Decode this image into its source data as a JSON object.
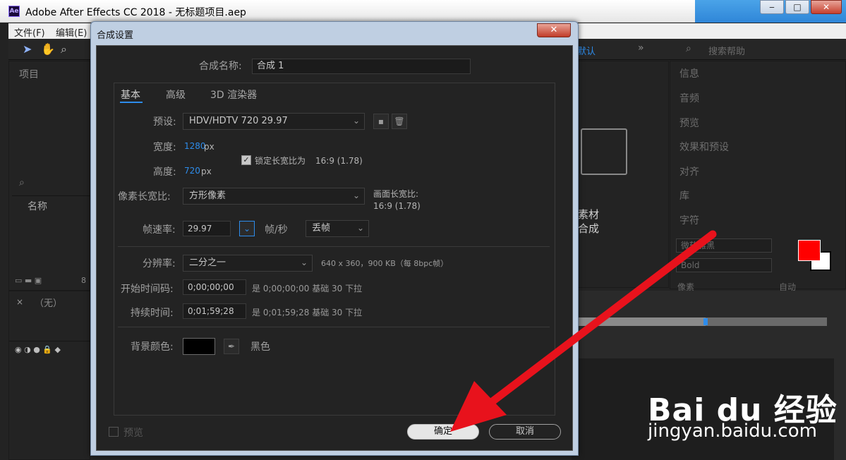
{
  "window": {
    "title": "Adobe After Effects CC 2018 - 无标题项目.aep",
    "logo": "Ae",
    "buttons": [
      "‒",
      "□",
      "✕"
    ]
  },
  "menu": {
    "items": [
      "文件(F)",
      "编辑(E)"
    ]
  },
  "toolbar": {
    "default_label": "默认",
    "search_placeholder": "搜索帮助",
    "more": "»"
  },
  "project_panel": {
    "title": "项目",
    "name_col": "名称",
    "search_icon": "search-icon",
    "bpc": "8"
  },
  "timeline_panel": {
    "comp_tab": "（无）"
  },
  "right_panel": {
    "items": [
      "信息",
      "音频",
      "预览",
      "效果和预设",
      "对齐",
      "库",
      "字符"
    ],
    "font_family": "微软雅黑",
    "font_style": "Bold",
    "size_unit": "像素",
    "auto_label": "自动",
    "colors": {
      "fill": "#ff0000",
      "stroke": "#ffffff"
    }
  },
  "center_panel": {
    "line1": "素材",
    "line2": "合成"
  },
  "dialog": {
    "title": "合成设置",
    "close_label": "✕",
    "comp_name_label": "合成名称:",
    "comp_name_value": "合成 1",
    "tabs": [
      "基本",
      "高级",
      "3D 渲染器"
    ],
    "preset_label": "预设:",
    "preset_value": "HDV/HDTV 720 29.97",
    "width_label": "宽度:",
    "width_value": "1280",
    "height_label": "高度:",
    "height_value": "720",
    "px_unit": "px",
    "lock_aspect_label": "锁定长宽比为",
    "lock_aspect_ratio": "16:9 (1.78)",
    "pixel_aspect_label": "像素长宽比:",
    "pixel_aspect_value": "方形像素",
    "frame_aspect_label": "画面长宽比:",
    "frame_aspect_value": "16:9 (1.78)",
    "frame_rate_label": "帧速率:",
    "frame_rate_value": "29.97",
    "fps_unit": "帧/秒",
    "drop_frame": "丢帧",
    "resolution_label": "分辨率:",
    "resolution_value": "二分之一",
    "resolution_info": "640 x 360，900 KB（每 8bpc帧）",
    "start_tc_label": "开始时间码:",
    "start_tc_value": "0;00;00;00",
    "start_tc_info": "是 0;00;00;00  基础 30  下拉",
    "duration_label": "持续时间:",
    "duration_value": "0;01;59;28",
    "duration_info": "是 0;01;59;28  基础 30  下拉",
    "bg_color_label": "背景颜色:",
    "bg_color_name": "黑色",
    "bg_color": "#000000",
    "preview_label": "预览",
    "ok_label": "确定",
    "cancel_label": "取消"
  },
  "watermark": {
    "brand": "Bai du 经验",
    "url": "jingyan.baidu.com"
  },
  "annotation": {
    "arrow_color": "#e8121c"
  }
}
